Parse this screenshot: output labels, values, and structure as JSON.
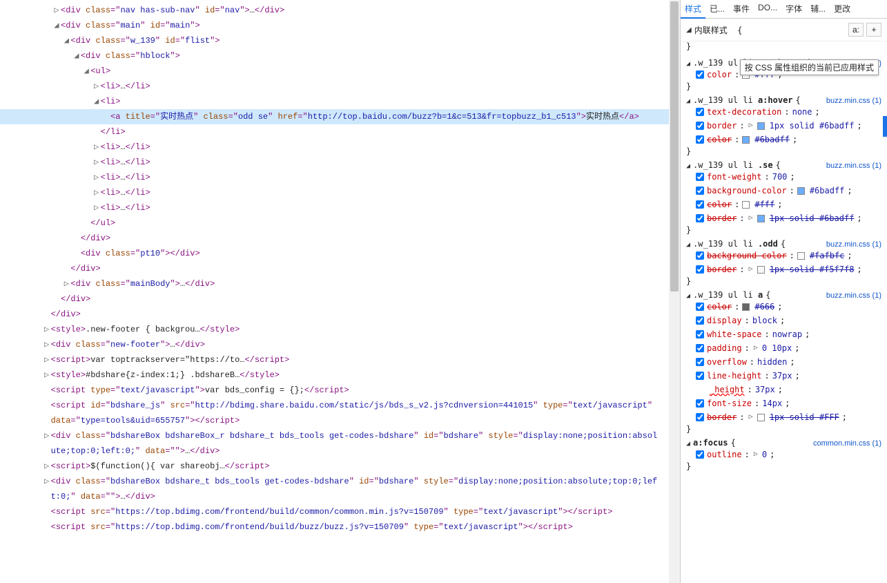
{
  "tabs": [
    "样式",
    "已...",
    "事件",
    "DO...",
    "字体",
    "辅...",
    "更改"
  ],
  "active_tab": 0,
  "inline_label": "内联样式",
  "inline_btns": {
    "a": "a:",
    "plus": "+"
  },
  "tooltip": "按 CSS 属性组织的当前已应用样式",
  "closing_brace": "}",
  "brace_open": "{",
  "dom": [
    {
      "indent": 5,
      "arrow": "▷",
      "parts": [
        {
          "t": "open",
          "name": "div",
          "attrs": [
            [
              "class",
              "nav has-sub-nav"
            ],
            [
              "id",
              "nav"
            ]
          ]
        },
        {
          "t": "text",
          "v": "…"
        },
        {
          "t": "close",
          "name": "div"
        }
      ]
    },
    {
      "indent": 5,
      "arrow": "◢",
      "parts": [
        {
          "t": "open",
          "name": "div",
          "attrs": [
            [
              "class",
              "main"
            ],
            [
              "id",
              "main"
            ]
          ]
        }
      ]
    },
    {
      "indent": 6,
      "arrow": "◢",
      "parts": [
        {
          "t": "open",
          "name": "div",
          "attrs": [
            [
              "class",
              "w_139"
            ],
            [
              "id",
              "flist"
            ]
          ]
        }
      ]
    },
    {
      "indent": 7,
      "arrow": "◢",
      "parts": [
        {
          "t": "open",
          "name": "div",
          "attrs": [
            [
              "class",
              "hblock"
            ]
          ]
        }
      ]
    },
    {
      "indent": 8,
      "arrow": "◢",
      "parts": [
        {
          "t": "open",
          "name": "ul",
          "attrs": []
        }
      ]
    },
    {
      "indent": 9,
      "arrow": "▷",
      "parts": [
        {
          "t": "open",
          "name": "li",
          "attrs": []
        },
        {
          "t": "text",
          "v": "…"
        },
        {
          "t": "close",
          "name": "li"
        }
      ]
    },
    {
      "indent": 9,
      "arrow": "◢",
      "parts": [
        {
          "t": "open",
          "name": "li",
          "attrs": []
        }
      ]
    },
    {
      "indent": 10,
      "arrow": "",
      "hl": true,
      "parts": [
        {
          "t": "open",
          "name": "a",
          "attrs": [
            [
              "title",
              "实时热点"
            ],
            [
              "class",
              "odd se"
            ],
            [
              "href",
              "http://top.baidu.com/buzz?b=1&c=513&fr=topbuzz_b1_c513"
            ]
          ]
        },
        {
          "t": "text",
          "v": "实时热点"
        },
        {
          "t": "close",
          "name": "a"
        }
      ],
      "wrap_indent": 11
    },
    {
      "indent": 9,
      "arrow": "",
      "parts": [
        {
          "t": "close",
          "name": "li"
        }
      ]
    },
    {
      "indent": 9,
      "arrow": "▷",
      "parts": [
        {
          "t": "open",
          "name": "li",
          "attrs": []
        },
        {
          "t": "text",
          "v": "…"
        },
        {
          "t": "close",
          "name": "li"
        }
      ]
    },
    {
      "indent": 9,
      "arrow": "▷",
      "parts": [
        {
          "t": "open",
          "name": "li",
          "attrs": []
        },
        {
          "t": "text",
          "v": "…"
        },
        {
          "t": "close",
          "name": "li"
        }
      ]
    },
    {
      "indent": 9,
      "arrow": "▷",
      "parts": [
        {
          "t": "open",
          "name": "li",
          "attrs": []
        },
        {
          "t": "text",
          "v": "…"
        },
        {
          "t": "close",
          "name": "li"
        }
      ]
    },
    {
      "indent": 9,
      "arrow": "▷",
      "parts": [
        {
          "t": "open",
          "name": "li",
          "attrs": []
        },
        {
          "t": "text",
          "v": "…"
        },
        {
          "t": "close",
          "name": "li"
        }
      ]
    },
    {
      "indent": 9,
      "arrow": "▷",
      "parts": [
        {
          "t": "open",
          "name": "li",
          "attrs": []
        },
        {
          "t": "text",
          "v": "…"
        },
        {
          "t": "close",
          "name": "li"
        }
      ]
    },
    {
      "indent": 8,
      "arrow": "",
      "parts": [
        {
          "t": "close",
          "name": "ul"
        }
      ]
    },
    {
      "indent": 7,
      "arrow": "",
      "parts": [
        {
          "t": "close",
          "name": "div"
        }
      ]
    },
    {
      "indent": 7,
      "arrow": "",
      "parts": [
        {
          "t": "open",
          "name": "div",
          "attrs": [
            [
              "class",
              "pt10"
            ]
          ]
        },
        {
          "t": "close",
          "name": "div"
        }
      ]
    },
    {
      "indent": 6,
      "arrow": "",
      "parts": [
        {
          "t": "close",
          "name": "div"
        }
      ]
    },
    {
      "indent": 6,
      "arrow": "▷",
      "parts": [
        {
          "t": "open",
          "name": "div",
          "attrs": [
            [
              "class",
              "mainBody"
            ]
          ]
        },
        {
          "t": "text",
          "v": "…"
        },
        {
          "t": "close",
          "name": "div"
        }
      ]
    },
    {
      "indent": 5,
      "arrow": "",
      "parts": [
        {
          "t": "close",
          "name": "div"
        }
      ]
    },
    {
      "indent": 4,
      "arrow": "",
      "parts": [
        {
          "t": "close",
          "name": "div"
        }
      ]
    },
    {
      "indent": 4,
      "arrow": "▷",
      "parts": [
        {
          "t": "open",
          "name": "style",
          "attrs": []
        },
        {
          "t": "text",
          "v": ".new-footer { backgrou…"
        },
        {
          "t": "close",
          "name": "style"
        }
      ]
    },
    {
      "indent": 4,
      "arrow": "▷",
      "parts": [
        {
          "t": "open",
          "name": "div",
          "attrs": [
            [
              "class",
              "new-footer"
            ]
          ]
        },
        {
          "t": "text",
          "v": "…"
        },
        {
          "t": "close",
          "name": "div"
        }
      ]
    },
    {
      "indent": 4,
      "arrow": "▷",
      "parts": [
        {
          "t": "open",
          "name": "script",
          "attrs": []
        },
        {
          "t": "text",
          "v": "var toptrackserver=\"https://to…"
        },
        {
          "t": "close",
          "name": "script"
        }
      ]
    },
    {
      "indent": 4,
      "arrow": "▷",
      "parts": [
        {
          "t": "open",
          "name": "style",
          "attrs": []
        },
        {
          "t": "text",
          "v": "#bdshare{z-index:1;} .bdshareB…"
        },
        {
          "t": "close",
          "name": "style"
        }
      ]
    },
    {
      "indent": 4,
      "arrow": "",
      "parts": [
        {
          "t": "open",
          "name": "script",
          "attrs": [
            [
              "type",
              "text/javascript"
            ]
          ]
        },
        {
          "t": "text",
          "v": "var bds_config = {};"
        },
        {
          "t": "close",
          "name": "script"
        }
      ]
    },
    {
      "indent": 4,
      "arrow": "",
      "parts": [
        {
          "t": "open",
          "name": "script",
          "attrs": [
            [
              "id",
              "bdshare_js"
            ],
            [
              "src",
              "http://bdimg.share.baidu.com/static/js/bds_s_v2.js?cdnversion=441015"
            ],
            [
              "type",
              "text/javascript"
            ],
            [
              "data",
              "type=tools&uid=655757"
            ]
          ]
        },
        {
          "t": "close",
          "name": "script"
        }
      ],
      "wrap_indent": 4
    },
    {
      "indent": 4,
      "arrow": "▷",
      "parts": [
        {
          "t": "open",
          "name": "div",
          "attrs": [
            [
              "class",
              "bdshareBox bdshareBox_r bdshare_t bds_tools get-codes-bdshare"
            ],
            [
              "id",
              "bdshare"
            ],
            [
              "style",
              "display:none;position:absolute;top:0;left:0;"
            ],
            [
              "data",
              ""
            ]
          ]
        },
        {
          "t": "text",
          "v": "…"
        },
        {
          "t": "close",
          "name": "div"
        }
      ],
      "wrap_indent": 4
    },
    {
      "indent": 4,
      "arrow": "▷",
      "parts": [
        {
          "t": "open",
          "name": "script",
          "attrs": []
        },
        {
          "t": "text",
          "v": "$(function(){ var shareobj…"
        },
        {
          "t": "close",
          "name": "script"
        }
      ]
    },
    {
      "indent": 4,
      "arrow": "▷",
      "parts": [
        {
          "t": "open",
          "name": "div",
          "attrs": [
            [
              "class",
              "bdshareBox bdshare_t bds_tools get-codes-bdshare"
            ],
            [
              "id",
              "bdshare"
            ],
            [
              "style",
              "display:none;position:absolute;top:0;left:0;"
            ],
            [
              "data",
              ""
            ]
          ]
        },
        {
          "t": "text",
          "v": "…"
        },
        {
          "t": "close",
          "name": "div"
        }
      ],
      "wrap_indent": 4
    },
    {
      "indent": 4,
      "arrow": "",
      "parts": [
        {
          "t": "open",
          "name": "script",
          "attrs": [
            [
              "src",
              "https://top.bdimg.com/frontend/build/common/common.min.js?v=150709"
            ],
            [
              "type",
              "text/javascript"
            ]
          ]
        },
        {
          "t": "close",
          "name": "script"
        }
      ],
      "wrap_indent": 4
    },
    {
      "indent": 4,
      "arrow": "",
      "parts": [
        {
          "t": "open",
          "name": "script",
          "attrs": [
            [
              "src",
              "https://top.bdimg.com/frontend/build/buzz/buzz.js?v=150709"
            ],
            [
              "type",
              "text/javascript"
            ]
          ]
        },
        {
          "t": "close",
          "name": "script"
        }
      ]
    }
  ],
  "rules": [
    {
      "selector_pre": ".w_139 ul li ",
      "selector_match": ".se:hover",
      "source": "buzz.min.css (1)",
      "props": [
        {
          "name": "color",
          "val": "#fff",
          "swatch": "#ffffff",
          "checked": true
        }
      ]
    },
    {
      "selector_pre": ".w_139 ul li ",
      "selector_match": "a:hover",
      "source": "buzz.min.css (1)",
      "props": [
        {
          "name": "text-decoration",
          "val": "none",
          "checked": true
        },
        {
          "name": "border",
          "val": "1px solid #6badff",
          "swatch": "#6badff",
          "tri": true,
          "checked": true
        },
        {
          "name": "color",
          "val": "#6badff",
          "swatch": "#6badff",
          "strike": true,
          "checked": true
        }
      ]
    },
    {
      "selector_pre": ".w_139 ul li ",
      "selector_match": ".se",
      "source": "buzz.min.css (1)",
      "props": [
        {
          "name": "font-weight",
          "val": "700",
          "checked": true
        },
        {
          "name": "background-color",
          "val": "#6badff",
          "swatch": "#6badff",
          "checked": true
        },
        {
          "name": "color",
          "val": "#fff",
          "swatch": "#ffffff",
          "strike": true,
          "checked": true
        },
        {
          "name": "border",
          "val": "1px solid #6badff",
          "swatch": "#6badff",
          "tri": true,
          "strike": true,
          "checked": true
        }
      ]
    },
    {
      "selector_pre": ".w_139 ul li ",
      "selector_match": ".odd",
      "source": "buzz.min.css (1)",
      "props": [
        {
          "name": "background-color",
          "val": "#fafbfc",
          "swatch": "#fafbfc",
          "strike": true,
          "checked": true
        },
        {
          "name": "border",
          "val": "1px solid #f5f7f8",
          "swatch": "#f5f7f8",
          "tri": true,
          "strike": true,
          "checked": true
        }
      ]
    },
    {
      "selector_pre": ".w_139 ul li ",
      "selector_match": "a",
      "source": "buzz.min.css (1)",
      "props": [
        {
          "name": "color",
          "val": "#666",
          "swatch": "#666666",
          "strike": true,
          "checked": true
        },
        {
          "name": "display",
          "val": "block",
          "checked": true
        },
        {
          "name": "white-space",
          "val": "nowrap",
          "checked": true
        },
        {
          "name": "padding",
          "val": "0 10px",
          "tri": true,
          "checked": true
        },
        {
          "name": "overflow",
          "val": "hidden",
          "checked": true
        },
        {
          "name": "line-height",
          "val": "37px",
          "checked": true
        },
        {
          "name": "_height",
          "val": "37px",
          "invalid": true,
          "nocheck": true
        },
        {
          "name": "font-size",
          "val": "14px",
          "checked": true
        },
        {
          "name": "border",
          "val": "1px solid #FFF",
          "swatch": "#ffffff",
          "tri": true,
          "strike": true,
          "checked": true
        }
      ]
    },
    {
      "selector_pre": "",
      "selector_match": "a:focus",
      "source": "common.min.css (1)",
      "props": [
        {
          "name": "outline",
          "val": "0",
          "tri": true,
          "checked": true
        }
      ]
    }
  ]
}
